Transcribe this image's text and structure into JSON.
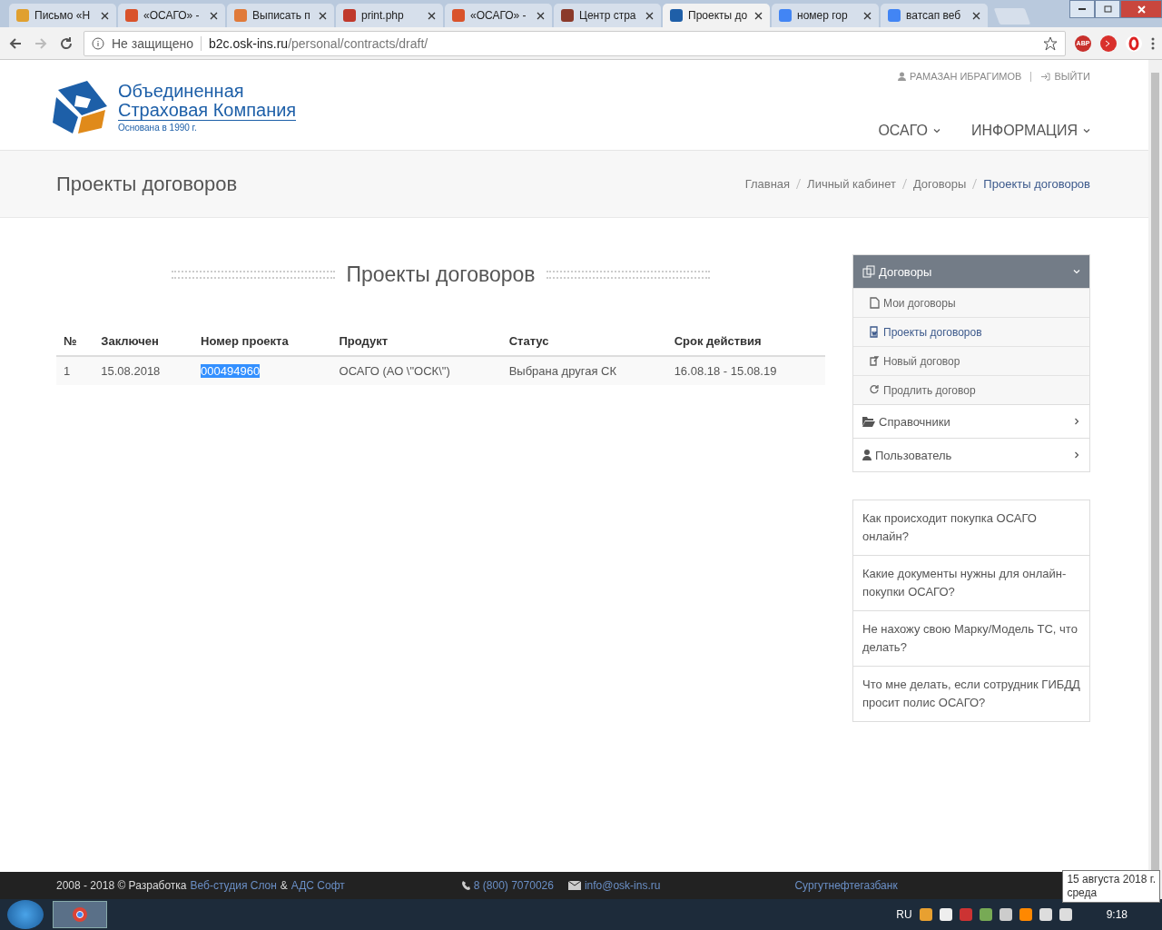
{
  "browser": {
    "tabs": [
      {
        "label": "Письмо «Н",
        "selected": false,
        "color": "#e0a030"
      },
      {
        "label": "«ОСАГО» -",
        "selected": false,
        "color": "#d9532b"
      },
      {
        "label": "Выписать п",
        "selected": false,
        "color": "#e07a3a"
      },
      {
        "label": "print.php",
        "selected": false,
        "color": "#c0392b"
      },
      {
        "label": "«ОСАГО» -",
        "selected": false,
        "color": "#d9532b"
      },
      {
        "label": "Центр стра",
        "selected": false,
        "color": "#8b3a2a"
      },
      {
        "label": "Проекты до",
        "selected": true,
        "color": "#1f5fa8"
      },
      {
        "label": "номер гор",
        "selected": false,
        "color": "#4285f4"
      },
      {
        "label": "ватсап веб",
        "selected": false,
        "color": "#4285f4"
      }
    ],
    "security": "Не защищено",
    "url_host": "b2c.osk-ins.ru",
    "url_path": "/personal/contracts/draft/",
    "extensions": [
      "ABP"
    ]
  },
  "header": {
    "logo_line1": "Объединенная",
    "logo_line2": "Страховая Компания",
    "logo_tagline": "Основана в 1990 г.",
    "user": "РАМАЗАН ИБРАГИМОВ",
    "logout": "ВЫЙТИ",
    "nav": [
      "ОСАГО",
      "ИНФОРМАЦИЯ"
    ]
  },
  "title_bar": {
    "title": "Проекты договоров",
    "breadcrumbs": [
      {
        "label": "Главная",
        "selected": false
      },
      {
        "label": "Личный кабинет",
        "selected": false
      },
      {
        "label": "Договоры",
        "selected": false
      },
      {
        "label": "Проекты договоров",
        "selected": true
      }
    ]
  },
  "section_title": "Проекты договоров",
  "table": {
    "columns": [
      "№",
      "Заключен",
      "Номер проекта",
      "Продукт",
      "Статус",
      "Срок действия"
    ],
    "rows": [
      {
        "cells": [
          {
            "text": "1",
            "selected": false
          },
          {
            "text": "15.08.2018",
            "selected": false
          },
          {
            "text": "000494960",
            "selected": true
          },
          {
            "text": "ОСАГО (АО \\\"ОСК\\\")",
            "selected": false
          },
          {
            "text": "Выбрана другая СК",
            "selected": false
          },
          {
            "text": "16.08.18 - 15.08.19",
            "selected": false
          }
        ]
      }
    ]
  },
  "sidebar": {
    "items": [
      {
        "label": "Договоры",
        "kind": "group",
        "expanded": true,
        "children": [
          {
            "label": "Мои договоры",
            "selected": false
          },
          {
            "label": "Проекты договоров",
            "selected": true
          },
          {
            "label": "Новый договор",
            "selected": false
          },
          {
            "label": "Продлить договор",
            "selected": false
          }
        ]
      },
      {
        "label": "Справочники",
        "kind": "link",
        "expanded": false
      },
      {
        "label": "Пользователь",
        "kind": "link",
        "expanded": false
      }
    ]
  },
  "faq": [
    "Как происходит покупка ОСАГО онлайн?",
    "Какие документы нужны для онлайн-покупки ОСАГО?",
    "Не нахожу свою Марку/Модель ТС, что делать?",
    "Что мне делать, если сотрудник ГИБДД просит полис ОСАГО?"
  ],
  "footer": {
    "copyright": "2008 - 2018 © Разработка",
    "dev1": "Веб-студия Слон",
    "amp": "&",
    "dev2": "АДС Софт",
    "phone": "8 (800) 7070026",
    "email": "info@osk-ins.ru",
    "partner": "Сургутнефтегазбанк"
  },
  "taskbar": {
    "language": "RU",
    "time": "9:18",
    "tooltip_date": "15 августа 2018 г.",
    "tooltip_day": "среда"
  }
}
